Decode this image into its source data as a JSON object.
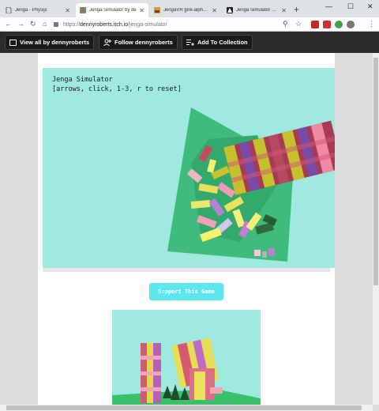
{
  "browser": {
    "tabs": [
      {
        "title": "Jenga - Physijs"
      },
      {
        "title": "Jenga Simulator by de"
      },
      {
        "title": "JengaVR [pre-alpha] b"
      },
      {
        "title": "Jenga Simulator by S"
      }
    ],
    "url": {
      "scheme": "https://",
      "host": "dennyroberts.itch.io",
      "path": "/jenga-simulator"
    }
  },
  "itch_bar": {
    "view_all": "View all by dennyroberts",
    "follow": "Follow dennyroberts",
    "collection": "Add To Collection"
  },
  "game": {
    "title": "Jenga Simulator",
    "instructions": "[arrows, click, 1-3, r to reset]"
  },
  "support_button": "Support This Game"
}
